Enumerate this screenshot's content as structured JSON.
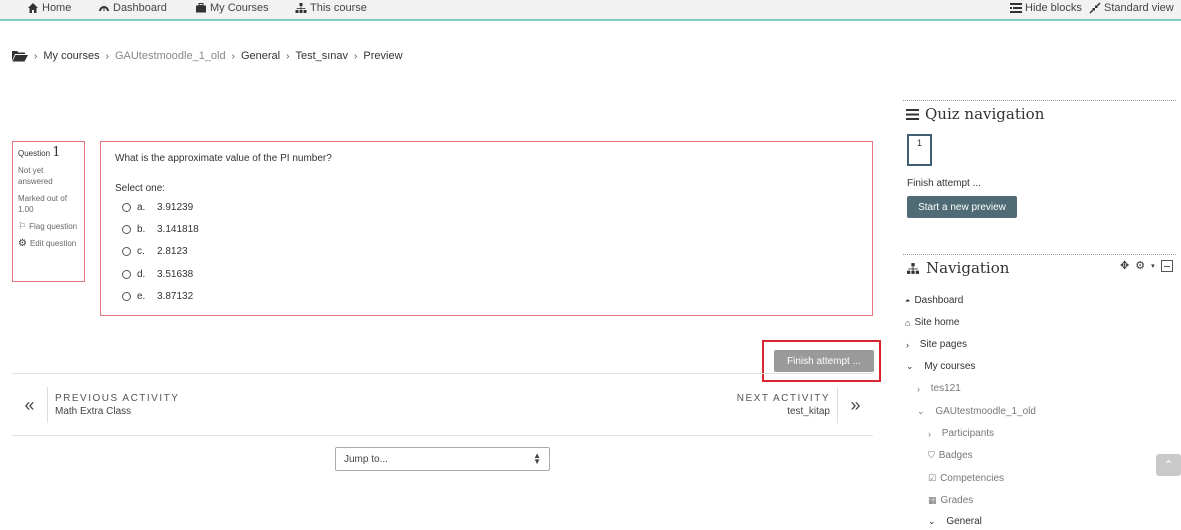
{
  "topbar": {
    "home": "Home",
    "dashboard": "Dashboard",
    "my_courses": "My Courses",
    "this_course": "This course",
    "hide_blocks": "Hide blocks",
    "standard_view": "Standard view"
  },
  "breadcrumb": {
    "items": [
      "My courses",
      "GAUtestmoodle_1_old",
      "General",
      "Test_sınav",
      "Preview"
    ]
  },
  "question_info": {
    "label": "Question",
    "number": "1",
    "status": "Not yet answered",
    "marked": "Marked out of 1.00",
    "flag": "Flag question",
    "edit": "Edit question"
  },
  "question": {
    "text": "What is the approximate value of the PI number?",
    "prompt": "Select one:",
    "options": [
      {
        "letter": "a.",
        "value": "3.91239"
      },
      {
        "letter": "b.",
        "value": "3.141818"
      },
      {
        "letter": "c.",
        "value": "2.8123"
      },
      {
        "letter": "d.",
        "value": "3.51638"
      },
      {
        "letter": "e.",
        "value": "3.87132"
      }
    ]
  },
  "finish_button": "Finish attempt ...",
  "prev_activity": {
    "label": "PREVIOUS ACTIVITY",
    "name": "Math Extra Class"
  },
  "next_activity": {
    "label": "NEXT ACTIVITY",
    "name": "test_kitap"
  },
  "jump": {
    "value": "Jump to...",
    "icon": "updown-icon"
  },
  "quiz_nav": {
    "title": "Quiz navigation",
    "button": "1",
    "finish_link": "Finish attempt ...",
    "start_new": "Start a new preview"
  },
  "navigation": {
    "title": "Navigation",
    "items": {
      "dashboard": "Dashboard",
      "site_home": "Site home",
      "site_pages": "Site pages",
      "my_courses": "My courses",
      "tes121": "tes121",
      "course": "GAUtestmoodle_1_old",
      "participants": "Participants",
      "badges": "Badges",
      "competencies": "Competencies",
      "grades": "Grades",
      "general": "General"
    }
  },
  "colors": {
    "accent_line": "#7fcdc5",
    "question_border": "#e5747c",
    "highlight_red": "#d9252d",
    "primary_button": "#4f6b75"
  }
}
